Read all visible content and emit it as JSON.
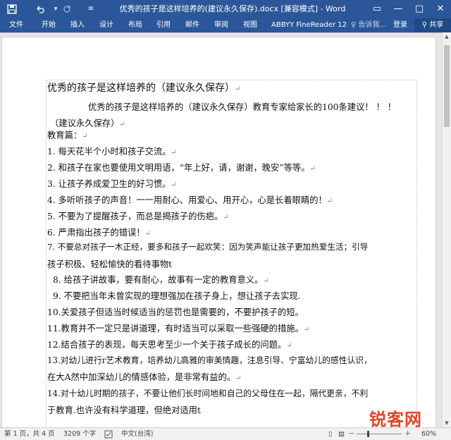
{
  "titlebar": {
    "title": "优秀的孩子是这样培养的(建议永久保存).docx [兼容模式] - Word",
    "quick_access": {
      "save_icon": "save-icon",
      "undo_icon": "undo-icon",
      "redo_icon": "redo-icon",
      "customize_icon": "customize-icon"
    },
    "window_controls": {
      "ribbon_options": "▭",
      "minimize": "—",
      "maximize": "□",
      "close": "✕"
    }
  },
  "ribbon": {
    "tabs": [
      "文件",
      "开始",
      "插入",
      "设计",
      "布局",
      "引用",
      "邮件",
      "审阅",
      "视图",
      "ABBYY FineReader 12"
    ],
    "tell_me": "告诉我...",
    "login": "登录",
    "share": "共享"
  },
  "document": {
    "lines": [
      "优秀的孩子是这样培养的（建议永久保存）",
      "优秀的孩子是这样培养的（建议永久保存）教育专家给家长的100条建议！ ！ ！",
      "（建议永久保存）",
      "教育篇：",
      "1.  每天花半个小时和孩子交流。",
      "2.  和孩子在家也要使用文明用语，“年上好，请，谢谢，晚安”等等。",
      "3.  让孩子养成爱卫生的好习惯。",
      "4.  多听听孩子的声音！一一用耐心、用爱心、用开心，心是长着眼睛的！",
      "5.  不要为了提醒孩子，而总是揭孩子的伤疤。",
      "6.  严肃指出孩子的错误！",
      "7.  不要总对孩子一木正经，要多和孩子一起欢笑：因为笑声能让孩子更加热爱生活；引导",
      "孩子积极、轻松愉快的看待事物t",
      "8. 给孩子讲故事，要有耐心，故事有一定的教育意义。",
      "9. 不要把当年未曾实现的理想强加在孩子身上，想让孩子去实现.",
      "10.关爱孩子但适当时候适当的惩罚也是需要的，不要护孩子的短。",
      "11.教育并不一定只是讲道理，有时适当可以采取一些强硬的措施。",
      "12.结合孩子的表现，每天思考至少一个关于孩子成长的问题。",
      "13.对幼儿进行r艺术教育，培养幼儿高雅的审美情趣，注息引导、宁富幼儿的感性认识，",
      "在大A然中加深幼儿的情感体验，是非常有益的。",
      "14.对十幼儿时期的孩子，不要让他们长时间地和自己的父母住在一起，隔代更亲，不利",
      "于教育.也许没有科学道理，但绝对适用t"
    ],
    "paragraph_mark": "↵"
  },
  "statusbar": {
    "page": "第 1 页，共 4 页",
    "words": "3209 个字",
    "language": "中文(台湾)",
    "zoom": "60%",
    "zoom_minus": "－",
    "zoom_plus": "＋"
  },
  "watermark": {
    "text": "锐客网"
  },
  "colors": {
    "accent": "#2b579a",
    "watermark": "#e0462a"
  }
}
